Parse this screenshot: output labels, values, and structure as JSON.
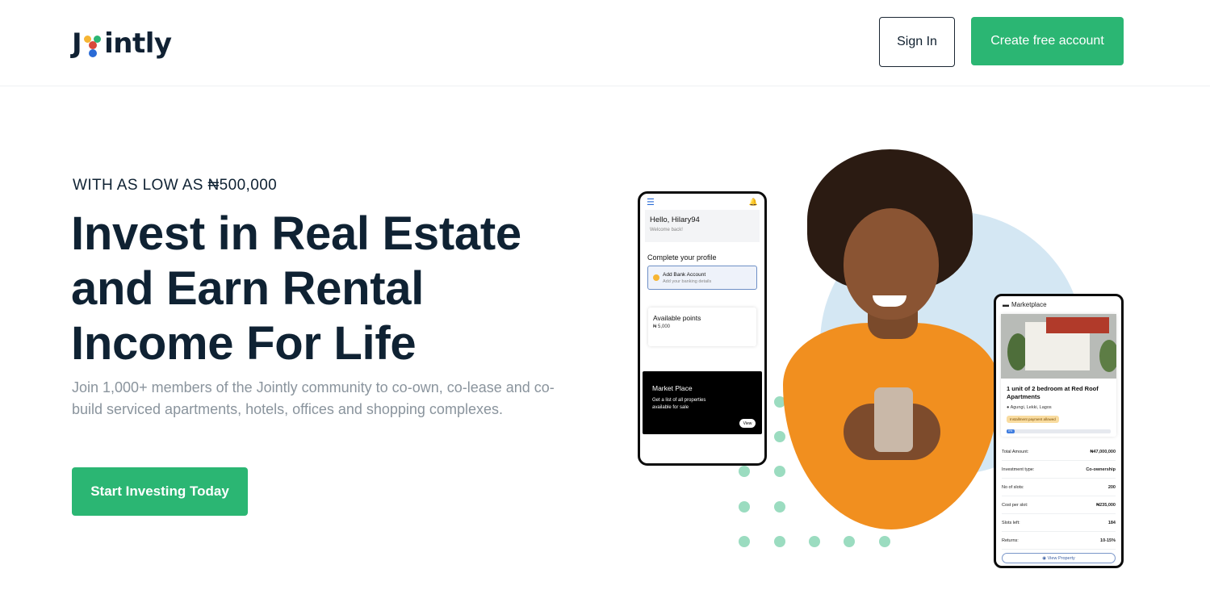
{
  "header": {
    "logo_prefix": "J",
    "logo_suffix": "intly",
    "logo_colors": [
      "#f6b533",
      "#2bb673",
      "#d94a3a",
      "#2a6bd6"
    ],
    "sign_in_label": "Sign In",
    "create_account_label": "Create free account"
  },
  "hero": {
    "eyebrow": "WITH AS LOW AS ₦500,000",
    "headline": "Invest in Real Estate and Earn Rental Income For Life",
    "subtext": "Join 1,000+ members of the Jointly community to co-own, co-lease and co-build serviced apartments, hotels, offices and shopping complexes.",
    "cta_label": "Start Investing Today"
  },
  "phone_left": {
    "greeting": "Hello, Hilary94",
    "welcome": "Welcome back!",
    "complete_profile": "Complete your profile",
    "bank_title": "Add Bank Account",
    "bank_subtitle": "Add your banking details",
    "points_title": "Available points",
    "points_value": "₦ 5,000",
    "market_title": "Market Place",
    "market_desc": "Get a list of all properties available for sale",
    "market_view": "View"
  },
  "phone_right": {
    "header": "Marketplace",
    "listing_title": "1 unit of 2 bedroom at Red Roof Apartments",
    "location": "Agungi, Lekki, Lagos",
    "badge": "Installment payment allowed",
    "progress_text": "0%",
    "progress_fraction": 0.08,
    "rows": [
      {
        "label": "Total Amount:",
        "value": "₦47,000,000"
      },
      {
        "label": "Investment type:",
        "value": "Co-ownership"
      },
      {
        "label": "No of slots:",
        "value": "200"
      },
      {
        "label": "Cost per slot:",
        "value": "₦235,000"
      },
      {
        "label": "Slots left:",
        "value": "184"
      },
      {
        "label": "Returns:",
        "value": "10-15%"
      }
    ],
    "view_button": "View Property"
  },
  "colors": {
    "brand_green": "#2bb673",
    "navy": "#0f2233",
    "muted": "#8a949d"
  }
}
